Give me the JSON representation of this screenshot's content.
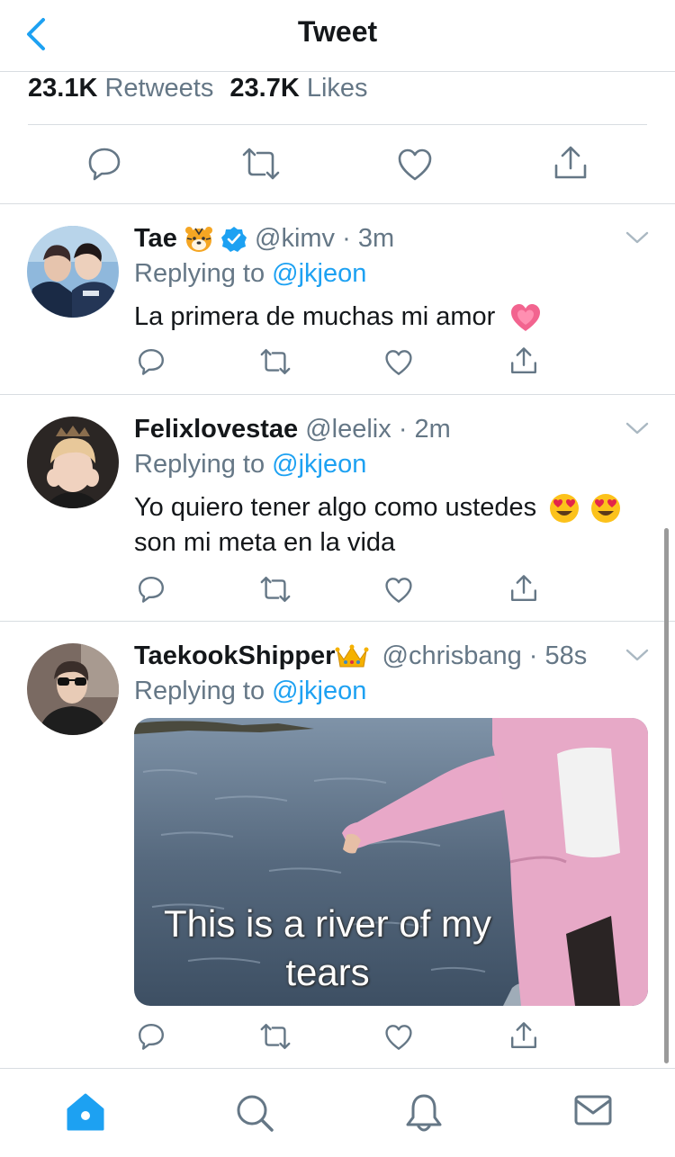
{
  "header": {
    "title": "Tweet"
  },
  "stats": {
    "retweets_count": "23.1K",
    "retweets_label": "Retweets",
    "likes_count": "23.7K",
    "likes_label": "Likes"
  },
  "colors": {
    "accent": "#1da1f2",
    "secondary_text": "#657786",
    "primary_text": "#14171a",
    "divider": "#d8dde1",
    "heart_emoji": "#e8457a"
  },
  "icons": {
    "back": "chevron-left-icon",
    "reply": "speech-bubble-icon",
    "retweet": "retweet-arrows-icon",
    "like": "heart-outline-icon",
    "share": "share-upload-icon",
    "more": "chevron-down-icon",
    "verified": "verified-badge-icon",
    "home": "home-icon",
    "search": "search-icon",
    "notifications": "bell-icon",
    "messages": "envelope-icon"
  },
  "tweets": [
    {
      "name": "Tae",
      "name_emoji": "tiger-face-emoji",
      "verified": true,
      "handle": "@kimv",
      "time": "· 3m",
      "replying_label": "Replying to",
      "replying_to": "@jkjeon",
      "text": "La primera de muchas mi amor",
      "text_emoji": "growing-heart-emoji"
    },
    {
      "name": "Felixlovestae",
      "handle": "@leelix",
      "time": "· 2m",
      "replying_label": "Replying to",
      "replying_to": "@jkjeon",
      "text_line1": "Yo quiero tener algo como ustedes",
      "text_line2": "son mi meta en la vida",
      "text_emoji": "heart-eyes-emoji"
    },
    {
      "name": "TaekookShipper",
      "name_emoji": "crown-emoji",
      "handle": "@chrisbang",
      "time": "· 58s",
      "replying_label": "Replying to",
      "replying_to": "@jkjeon",
      "media_caption_line1": "This is a river of my",
      "media_caption_line2": "tears"
    }
  ]
}
